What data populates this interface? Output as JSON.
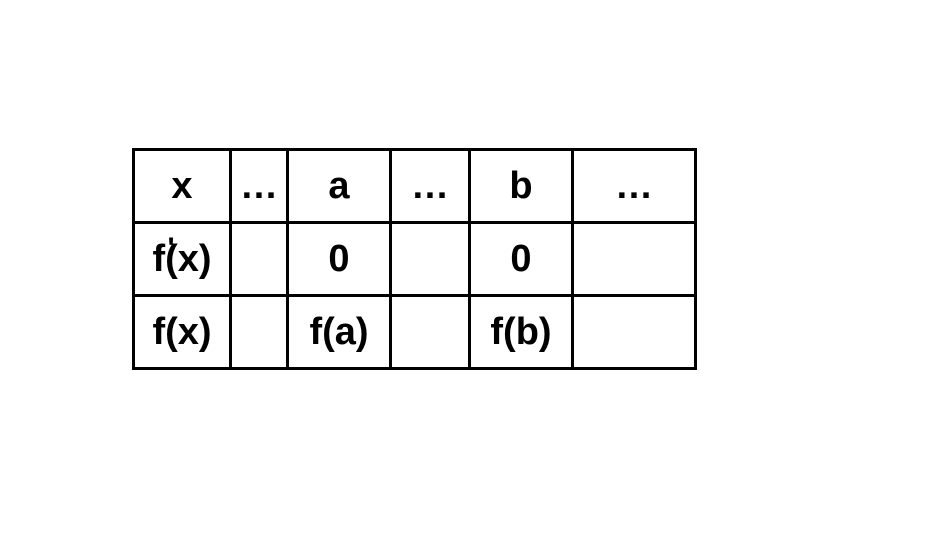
{
  "chart_data": {
    "type": "table",
    "rows": [
      [
        "x",
        "…",
        "a",
        "…",
        "b",
        "…"
      ],
      [
        "f'(x)",
        "",
        "0",
        "",
        "0",
        ""
      ],
      [
        "f(x)",
        "",
        "f(a)",
        "",
        "f(b)",
        ""
      ]
    ]
  },
  "table": {
    "r1": {
      "c1": "x",
      "c2": "…",
      "c3": "a",
      "c4": "…",
      "c5": "b",
      "c6": "…"
    },
    "r2": {
      "c1": "f(x)",
      "c2": "",
      "c3": "0",
      "c4": "",
      "c5": "0",
      "c6": ""
    },
    "r3": {
      "c1": "f(x)",
      "c2": "",
      "c3": "f(a)",
      "c4": "",
      "c5": "f(b)",
      "c6": ""
    }
  }
}
